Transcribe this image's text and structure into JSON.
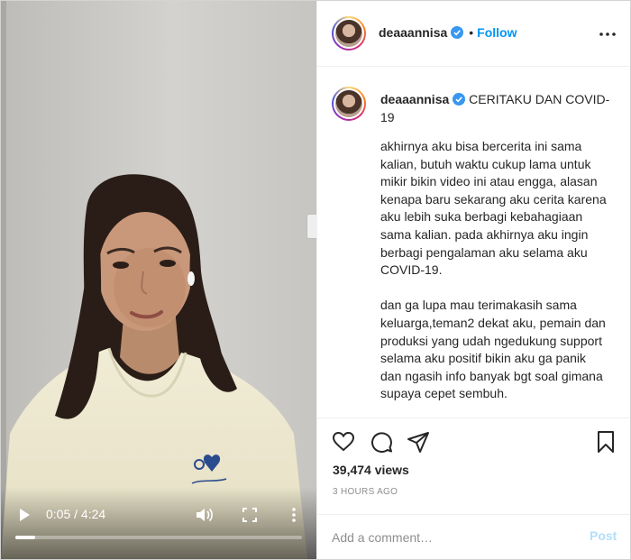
{
  "video": {
    "time_display": "0:05 / 4:24",
    "progress_fraction": 0.07
  },
  "post": {
    "username": "deaaannisa",
    "follow_label": "Follow",
    "separator": "•",
    "caption_title": "CERITAKU DAN COVID-19",
    "caption_body": "akhirnya aku bisa bercerita ini sama kalian, butuh waktu cukup lama untuk mikir bikin video ini atau engga, alasan kenapa baru sekarang aku cerita karena aku lebih suka berbagi kebahagiaan sama kalian. pada akhirnya aku ingin berbagi pengalaman aku selama aku COVID-19.\n\ndan ga lupa mau terimakasih sama keluarga,teman2 dekat aku, pemain dan produksi yang udah ngedukung support selama aku positif bikin aku ga panik dan ngasih info banyak bgt soal gimana supaya cepet sembuh.",
    "views": "39,474 views",
    "time_ago": "3 HOURS AGO"
  },
  "comment": {
    "placeholder": "Add a comment…",
    "post_label": "Post"
  },
  "colors": {
    "link_blue": "#0095f6",
    "post_disabled": "#b2dffc",
    "verified_blue": "#3897f0",
    "muted_text": "#8e8e8e"
  },
  "icons": [
    "play-icon",
    "volume-icon",
    "fullscreen-icon",
    "more-vertical-icon",
    "verified-badge-icon",
    "more-horizontal-icon",
    "heart-icon",
    "comment-icon",
    "share-icon",
    "bookmark-icon"
  ]
}
